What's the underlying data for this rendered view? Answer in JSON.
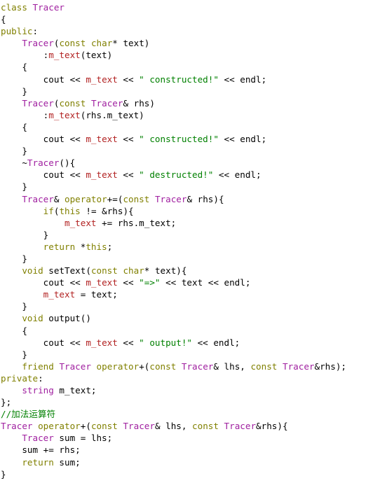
{
  "editor": {
    "language": "cpp",
    "background": "#ffffff",
    "font_size_px": 12.6,
    "line_height_px": 17.1,
    "colors": {
      "keyword": "#808000",
      "type": "#A020A0",
      "string": "#008000",
      "comment": "#008000",
      "member_variable": "#B22222",
      "plain": "#000000"
    }
  },
  "code": {
    "lines": [
      [
        {
          "t": "kw",
          "s": "class"
        },
        {
          "t": "pln",
          "s": " "
        },
        {
          "t": "type",
          "s": "Tracer"
        }
      ],
      [
        {
          "t": "pln",
          "s": "{"
        }
      ],
      [
        {
          "t": "kw",
          "s": "public"
        },
        {
          "t": "pln",
          "s": ":"
        }
      ],
      [
        {
          "t": "pln",
          "s": "    "
        },
        {
          "t": "type",
          "s": "Tracer"
        },
        {
          "t": "pln",
          "s": "("
        },
        {
          "t": "kw",
          "s": "const"
        },
        {
          "t": "pln",
          "s": " "
        },
        {
          "t": "kw",
          "s": "char"
        },
        {
          "t": "pln",
          "s": "* text)"
        }
      ],
      [
        {
          "t": "pln",
          "s": "        :"
        },
        {
          "t": "mem",
          "s": "m_text"
        },
        {
          "t": "pln",
          "s": "(text)"
        }
      ],
      [
        {
          "t": "pln",
          "s": "    {"
        }
      ],
      [
        {
          "t": "pln",
          "s": "        cout << "
        },
        {
          "t": "mem",
          "s": "m_text"
        },
        {
          "t": "pln",
          "s": " << "
        },
        {
          "t": "str",
          "s": "\" constructed!\""
        },
        {
          "t": "pln",
          "s": " << endl;"
        }
      ],
      [
        {
          "t": "pln",
          "s": "    }"
        }
      ],
      [
        {
          "t": "pln",
          "s": "    "
        },
        {
          "t": "type",
          "s": "Tracer"
        },
        {
          "t": "pln",
          "s": "("
        },
        {
          "t": "kw",
          "s": "const"
        },
        {
          "t": "pln",
          "s": " "
        },
        {
          "t": "type",
          "s": "Tracer"
        },
        {
          "t": "pln",
          "s": "& rhs)"
        }
      ],
      [
        {
          "t": "pln",
          "s": "        :"
        },
        {
          "t": "mem",
          "s": "m_text"
        },
        {
          "t": "pln",
          "s": "(rhs.m_text)"
        }
      ],
      [
        {
          "t": "pln",
          "s": "    {"
        }
      ],
      [
        {
          "t": "pln",
          "s": "        cout << "
        },
        {
          "t": "mem",
          "s": "m_text"
        },
        {
          "t": "pln",
          "s": " << "
        },
        {
          "t": "str",
          "s": "\" constructed!\""
        },
        {
          "t": "pln",
          "s": " << endl;"
        }
      ],
      [
        {
          "t": "pln",
          "s": "    }"
        }
      ],
      [
        {
          "t": "pln",
          "s": "    ~"
        },
        {
          "t": "type",
          "s": "Tracer"
        },
        {
          "t": "pln",
          "s": "(){"
        }
      ],
      [
        {
          "t": "pln",
          "s": "        cout << "
        },
        {
          "t": "mem",
          "s": "m_text"
        },
        {
          "t": "pln",
          "s": " << "
        },
        {
          "t": "str",
          "s": "\" destructed!\""
        },
        {
          "t": "pln",
          "s": " << endl;"
        }
      ],
      [
        {
          "t": "pln",
          "s": "    }"
        }
      ],
      [
        {
          "t": "pln",
          "s": "    "
        },
        {
          "t": "type",
          "s": "Tracer"
        },
        {
          "t": "pln",
          "s": "& "
        },
        {
          "t": "kw",
          "s": "operator"
        },
        {
          "t": "pln",
          "s": "+=("
        },
        {
          "t": "kw",
          "s": "const"
        },
        {
          "t": "pln",
          "s": " "
        },
        {
          "t": "type",
          "s": "Tracer"
        },
        {
          "t": "pln",
          "s": "& rhs){"
        }
      ],
      [
        {
          "t": "pln",
          "s": "        "
        },
        {
          "t": "kw",
          "s": "if"
        },
        {
          "t": "pln",
          "s": "("
        },
        {
          "t": "kw",
          "s": "this"
        },
        {
          "t": "pln",
          "s": " != &rhs){"
        }
      ],
      [
        {
          "t": "pln",
          "s": "            "
        },
        {
          "t": "mem",
          "s": "m_text"
        },
        {
          "t": "pln",
          "s": " += rhs.m_text;"
        }
      ],
      [
        {
          "t": "pln",
          "s": "        }"
        }
      ],
      [
        {
          "t": "pln",
          "s": "        "
        },
        {
          "t": "kw",
          "s": "return"
        },
        {
          "t": "pln",
          "s": " *"
        },
        {
          "t": "kw",
          "s": "this"
        },
        {
          "t": "pln",
          "s": ";"
        }
      ],
      [
        {
          "t": "pln",
          "s": "    }"
        }
      ],
      [
        {
          "t": "pln",
          "s": "    "
        },
        {
          "t": "kw",
          "s": "void"
        },
        {
          "t": "pln",
          "s": " setText("
        },
        {
          "t": "kw",
          "s": "const"
        },
        {
          "t": "pln",
          "s": " "
        },
        {
          "t": "kw",
          "s": "char"
        },
        {
          "t": "pln",
          "s": "* text){"
        }
      ],
      [
        {
          "t": "pln",
          "s": "        cout << "
        },
        {
          "t": "mem",
          "s": "m_text"
        },
        {
          "t": "pln",
          "s": " << "
        },
        {
          "t": "str",
          "s": "\"=>\""
        },
        {
          "t": "pln",
          "s": " << text << endl;"
        }
      ],
      [
        {
          "t": "pln",
          "s": "        "
        },
        {
          "t": "mem",
          "s": "m_text"
        },
        {
          "t": "pln",
          "s": " = text;"
        }
      ],
      [
        {
          "t": "pln",
          "s": "    }"
        }
      ],
      [
        {
          "t": "pln",
          "s": "    "
        },
        {
          "t": "kw",
          "s": "void"
        },
        {
          "t": "pln",
          "s": " output()"
        }
      ],
      [
        {
          "t": "pln",
          "s": "    {"
        }
      ],
      [
        {
          "t": "pln",
          "s": "        cout << "
        },
        {
          "t": "mem",
          "s": "m_text"
        },
        {
          "t": "pln",
          "s": " << "
        },
        {
          "t": "str",
          "s": "\" output!\""
        },
        {
          "t": "pln",
          "s": " << endl;"
        }
      ],
      [
        {
          "t": "pln",
          "s": "    }"
        }
      ],
      [
        {
          "t": "pln",
          "s": "    "
        },
        {
          "t": "kw",
          "s": "friend"
        },
        {
          "t": "pln",
          "s": " "
        },
        {
          "t": "type",
          "s": "Tracer"
        },
        {
          "t": "pln",
          "s": " "
        },
        {
          "t": "kw",
          "s": "operator"
        },
        {
          "t": "pln",
          "s": "+("
        },
        {
          "t": "kw",
          "s": "const"
        },
        {
          "t": "pln",
          "s": " "
        },
        {
          "t": "type",
          "s": "Tracer"
        },
        {
          "t": "pln",
          "s": "& lhs, "
        },
        {
          "t": "kw",
          "s": "const"
        },
        {
          "t": "pln",
          "s": " "
        },
        {
          "t": "type",
          "s": "Tracer"
        },
        {
          "t": "pln",
          "s": "&rhs);"
        }
      ],
      [
        {
          "t": "kw",
          "s": "private"
        },
        {
          "t": "pln",
          "s": ":"
        }
      ],
      [
        {
          "t": "pln",
          "s": "    "
        },
        {
          "t": "type",
          "s": "string"
        },
        {
          "t": "pln",
          "s": " m_text;"
        }
      ],
      [
        {
          "t": "pln",
          "s": "};"
        }
      ],
      [
        {
          "t": "com",
          "s": "//加法运算符"
        }
      ],
      [
        {
          "t": "type",
          "s": "Tracer"
        },
        {
          "t": "pln",
          "s": " "
        },
        {
          "t": "kw",
          "s": "operator"
        },
        {
          "t": "pln",
          "s": "+("
        },
        {
          "t": "kw",
          "s": "const"
        },
        {
          "t": "pln",
          "s": " "
        },
        {
          "t": "type",
          "s": "Tracer"
        },
        {
          "t": "pln",
          "s": "& lhs, "
        },
        {
          "t": "kw",
          "s": "const"
        },
        {
          "t": "pln",
          "s": " "
        },
        {
          "t": "type",
          "s": "Tracer"
        },
        {
          "t": "pln",
          "s": "&rhs){"
        }
      ],
      [
        {
          "t": "pln",
          "s": "    "
        },
        {
          "t": "type",
          "s": "Tracer"
        },
        {
          "t": "pln",
          "s": " sum = lhs;"
        }
      ],
      [
        {
          "t": "pln",
          "s": "    sum += rhs;"
        }
      ],
      [
        {
          "t": "pln",
          "s": "    "
        },
        {
          "t": "kw",
          "s": "return"
        },
        {
          "t": "pln",
          "s": " sum;"
        }
      ],
      [
        {
          "t": "pln",
          "s": "}"
        }
      ]
    ],
    "plain_text": "class Tracer\n{\npublic:\n    Tracer(const char* text)\n        :m_text(text)\n    {\n        cout << m_text << \" constructed!\" << endl;\n    }\n    Tracer(const Tracer& rhs)\n        :m_text(rhs.m_text)\n    {\n        cout << m_text << \" constructed!\" << endl;\n    }\n    ~Tracer(){\n        cout << m_text << \" destructed!\" << endl;\n    }\n    Tracer& operator+=(const Tracer& rhs){\n        if(this != &rhs){\n            m_text += rhs.m_text;\n        }\n        return *this;\n    }\n    void setText(const char* text){\n        cout << m_text << \"=>\" << text << endl;\n        m_text = text;\n    }\n    void output()\n    {\n        cout << m_text << \" output!\" << endl;\n    }\n    friend Tracer operator+(const Tracer& lhs, const Tracer&rhs);\nprivate:\n    string m_text;\n};\n//加法运算符\nTracer operator+(const Tracer& lhs, const Tracer&rhs){\n    Tracer sum = lhs;\n    sum += rhs;\n    return sum;\n}"
  }
}
